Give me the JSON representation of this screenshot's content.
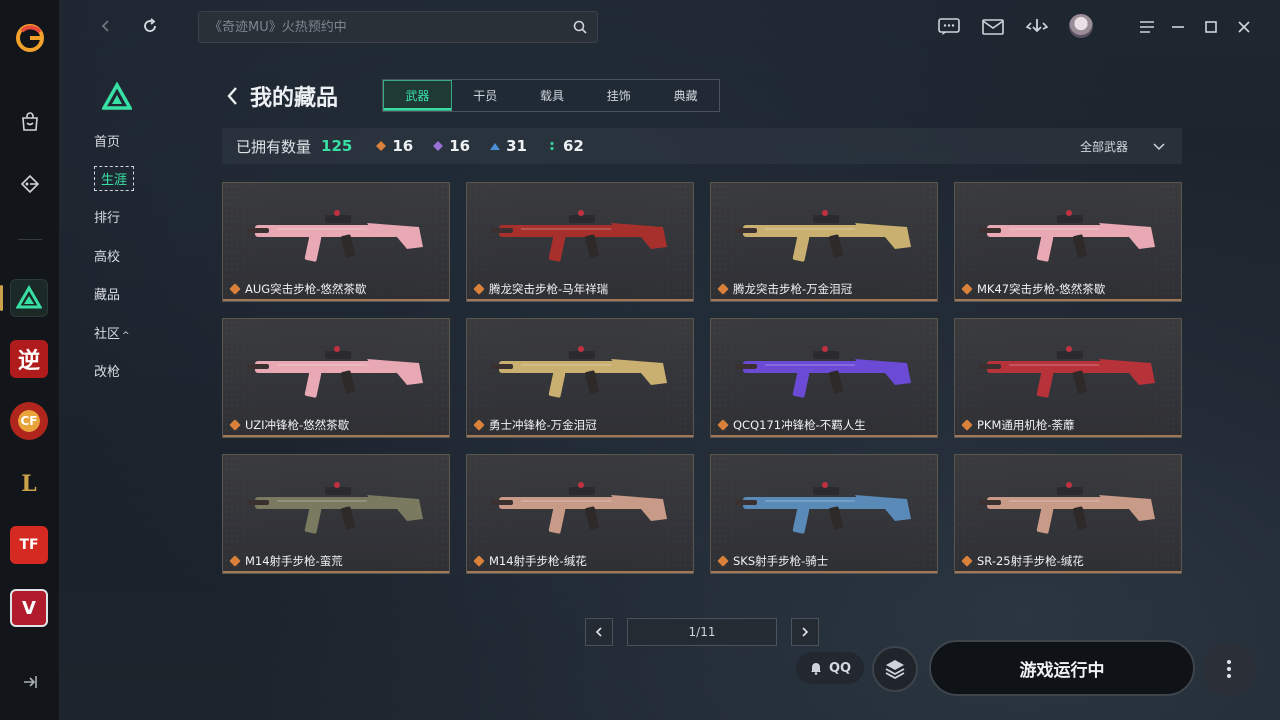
{
  "window": {
    "search_placeholder": "《奇迹MU》火热预约中",
    "icons": [
      "back-icon",
      "refresh-icon",
      "search-icon",
      "chat-icon",
      "mail-icon",
      "download-icon",
      "menu-icon",
      "minimize-icon",
      "maximize-icon",
      "close-icon"
    ]
  },
  "sidebar_games": [
    {
      "name": "pubg-game",
      "label": ""
    },
    {
      "name": "nz-game",
      "label": "逆"
    },
    {
      "name": "cf-game",
      "label": "CF"
    },
    {
      "name": "lol-game",
      "label": "L"
    },
    {
      "name": "tf-game",
      "label": "TF"
    },
    {
      "name": "valorant-game",
      "label": "V"
    }
  ],
  "subnav": {
    "items": [
      "首页",
      "生涯",
      "排行",
      "高校",
      "藏品",
      "社区",
      "改枪"
    ],
    "community_badge": "^"
  },
  "page": {
    "title": "我的藏品",
    "tabs": [
      "武器",
      "干员",
      "载具",
      "挂饰",
      "典藏"
    ],
    "active_tab": "武器"
  },
  "stats": {
    "label": "已拥有数量",
    "total": "125",
    "tiers": [
      {
        "name": "orange",
        "color": "#d9813a",
        "count": "16"
      },
      {
        "name": "purple",
        "color": "#9a6fd6",
        "count": "16"
      },
      {
        "name": "blue",
        "color": "#4b8fd6",
        "count": "31"
      },
      {
        "name": "green",
        "color": "#39c99a",
        "count": "62"
      }
    ],
    "filter_label": "全部武器"
  },
  "items": [
    {
      "name": "AUG突击步枪-悠然茶歇",
      "color": "#e8a8b4"
    },
    {
      "name": "腾龙突击步枪-马年祥瑞",
      "color": "#a8302c"
    },
    {
      "name": "腾龙突击步枪-万金泪冠",
      "color": "#c9b070"
    },
    {
      "name": "MK47突击步枪-悠然茶歇",
      "color": "#e8a8b4"
    },
    {
      "name": "UZI冲锋枪-悠然茶歇",
      "color": "#e8a8b4"
    },
    {
      "name": "勇士冲锋枪-万金泪冠",
      "color": "#c9b070"
    },
    {
      "name": "QCQ171冲锋枪-不羁人生",
      "color": "#6b4ad6"
    },
    {
      "name": "PKM通用机枪-荼蘼",
      "color": "#b8323a"
    },
    {
      "name": "M14射手步枪-蛮荒",
      "color": "#7a7a60"
    },
    {
      "name": "M14射手步枪-缄花",
      "color": "#c89a88"
    },
    {
      "name": "SKS射手步枪-骑士",
      "color": "#5a8ab8"
    },
    {
      "name": "SR-25射手步枪-缄花",
      "color": "#c89a88"
    }
  ],
  "pager": {
    "text": "1/11"
  },
  "bottom": {
    "qq_label": "QQ",
    "play_label": "游戏运行中"
  }
}
